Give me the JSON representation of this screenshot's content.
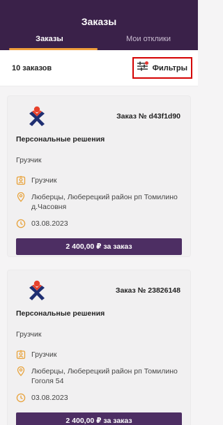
{
  "header": {
    "title": "Заказы",
    "tabs": [
      {
        "label": "Заказы"
      },
      {
        "label": "Мои отклики"
      }
    ]
  },
  "toolbar": {
    "count": "10 заказов",
    "filters_label": "Фильтры"
  },
  "orders": [
    {
      "order_no": "Заказ № d43f1d90",
      "company": "Персональные решения",
      "role": "Грузчик",
      "position": "Грузчик",
      "address": "Люберцы, Люберецкий район рп Томилино д.Часовня",
      "date": "03.08.2023",
      "price": "2 400,00 ₽ за заказ"
    },
    {
      "order_no": "Заказ № 23826148",
      "company": "Персональные решения",
      "role": "Грузчик",
      "position": "Грузчик",
      "address": "Люберцы, Люберецкий район рп Томилино Гоголя 54",
      "date": "03.08.2023",
      "price": "2 400,00 ₽ за заказ"
    }
  ],
  "colors": {
    "header_bg": "#3a2149",
    "tab_underline": "#f0a03c",
    "button_bg": "#4d2e63",
    "icon_accent": "#e8a23a",
    "filter_highlight": "#d40000"
  },
  "icons": {
    "filters": "sliders-icon",
    "logo": "company-logo",
    "position": "badge-icon",
    "address": "location-pin-icon",
    "date": "clock-icon"
  }
}
